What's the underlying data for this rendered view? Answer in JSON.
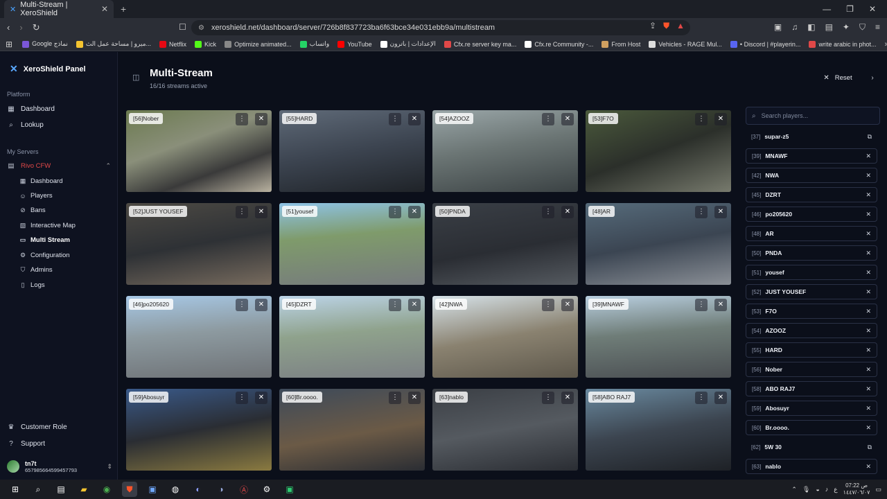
{
  "browser": {
    "tab_title": "Multi-Stream | XeroShield",
    "tab_close": "✕",
    "new_tab": "+",
    "window_controls": [
      "—",
      "❐",
      "✕"
    ],
    "url": "xeroshield.net/dashboard/server/726b8f837723ba6f63bce34e031ebb9a/multistream",
    "bookmarks": [
      {
        "label": "Google نماذج",
        "color": "#7b57d8"
      },
      {
        "label": "ميرو | مساحة عمل الث...",
        "color": "#f4c430"
      },
      {
        "label": "Netflix",
        "color": "#e50914"
      },
      {
        "label": "Kick",
        "color": "#53fc18"
      },
      {
        "label": "Optimize animated...",
        "color": "#888888"
      },
      {
        "label": "واتساب",
        "color": "#25d366"
      },
      {
        "label": "YouTube",
        "color": "#ff0000"
      },
      {
        "label": "الإعدادات | باترون",
        "color": "#ffffff"
      },
      {
        "label": "Cfx.re server key ma...",
        "color": "#e04848"
      },
      {
        "label": "Cfx.re Community -...",
        "color": "#ffffff"
      },
      {
        "label": "From Host",
        "color": "#d0a060"
      },
      {
        "label": "Vehicles - RAGE Mul...",
        "color": "#dddddd"
      },
      {
        "label": "• Discord | #playerin...",
        "color": "#5865f2"
      },
      {
        "label": "write arabic in phot...",
        "color": "#e04848"
      }
    ]
  },
  "sidebar": {
    "brand": "XeroShield Panel",
    "platform_label": "Platform",
    "platform_items": [
      {
        "label": "Dashboard",
        "icon": "grid-icon"
      },
      {
        "label": "Lookup",
        "icon": "search-icon"
      }
    ],
    "servers_label": "My Servers",
    "server_name": "Rivo CFW",
    "server_items": [
      {
        "label": "Dashboard",
        "icon": "grid-icon"
      },
      {
        "label": "Players",
        "icon": "users-icon"
      },
      {
        "label": "Bans",
        "icon": "ban-icon"
      },
      {
        "label": "Interactive Map",
        "icon": "map-icon"
      },
      {
        "label": "Multi Stream",
        "icon": "monitor-icon"
      },
      {
        "label": "Configuration",
        "icon": "gear-icon"
      },
      {
        "label": "Admins",
        "icon": "shield-icon"
      },
      {
        "label": "Logs",
        "icon": "file-icon"
      }
    ],
    "footer_items": [
      {
        "label": "Customer Role",
        "icon": "crown-icon"
      },
      {
        "label": "Support",
        "icon": "help-icon"
      }
    ],
    "user": {
      "name": "tn7t",
      "id": "657985664599457793"
    }
  },
  "header": {
    "title": "Multi-Stream",
    "subtitle": "16/16 streams active",
    "reset_label": "Reset"
  },
  "streams": [
    {
      "label": "[56]Nober"
    },
    {
      "label": "[55]HARD"
    },
    {
      "label": "[54]AZOOZ"
    },
    {
      "label": "[53]F7O"
    },
    {
      "label": "[52]JUST YOUSEF"
    },
    {
      "label": "[51]yousef"
    },
    {
      "label": "[50]PNDA"
    },
    {
      "label": "[48]AR"
    },
    {
      "label": "[46]po205620"
    },
    {
      "label": "[45]DZRT"
    },
    {
      "label": "[42]NWA"
    },
    {
      "label": "[39]MNAWF"
    },
    {
      "label": "[59]Abosuyr"
    },
    {
      "label": "[60]Br.oooo."
    },
    {
      "label": "[63]nablo"
    },
    {
      "label": "[58]ABO RAJ7"
    }
  ],
  "player_panel": {
    "search_placeholder": "Search players...",
    "players": [
      {
        "id": "[37]",
        "name": "supar-z5",
        "action": "⧉",
        "active": false
      },
      {
        "id": "[39]",
        "name": "MNAWF",
        "action": "✕",
        "active": true
      },
      {
        "id": "[42]",
        "name": "NWA",
        "action": "✕",
        "active": true
      },
      {
        "id": "[45]",
        "name": "DZRT",
        "action": "✕",
        "active": true
      },
      {
        "id": "[46]",
        "name": "po205620",
        "action": "✕",
        "active": true
      },
      {
        "id": "[48]",
        "name": "AR",
        "action": "✕",
        "active": true
      },
      {
        "id": "[50]",
        "name": "PNDA",
        "action": "✕",
        "active": true
      },
      {
        "id": "[51]",
        "name": "yousef",
        "action": "✕",
        "active": true
      },
      {
        "id": "[52]",
        "name": "JUST YOUSEF",
        "action": "✕",
        "active": true
      },
      {
        "id": "[53]",
        "name": "F7O",
        "action": "✕",
        "active": true
      },
      {
        "id": "[54]",
        "name": "AZOOZ",
        "action": "✕",
        "active": true
      },
      {
        "id": "[55]",
        "name": "HARD",
        "action": "✕",
        "active": true
      },
      {
        "id": "[56]",
        "name": "Nober",
        "action": "✕",
        "active": true
      },
      {
        "id": "[58]",
        "name": "ABO RAJ7",
        "action": "✕",
        "active": true
      },
      {
        "id": "[59]",
        "name": "Abosuyr",
        "action": "✕",
        "active": true
      },
      {
        "id": "[60]",
        "name": "Br.oooo.",
        "action": "✕",
        "active": true
      },
      {
        "id": "[62]",
        "name": "5W 30",
        "action": "⧉",
        "active": false
      },
      {
        "id": "[63]",
        "name": "nablo",
        "action": "✕",
        "active": true
      }
    ]
  },
  "taskbar": {
    "clock_time": "07:22 ص",
    "clock_date": "١٤٤٧/٠٦/٠٧",
    "lang": "ع"
  }
}
